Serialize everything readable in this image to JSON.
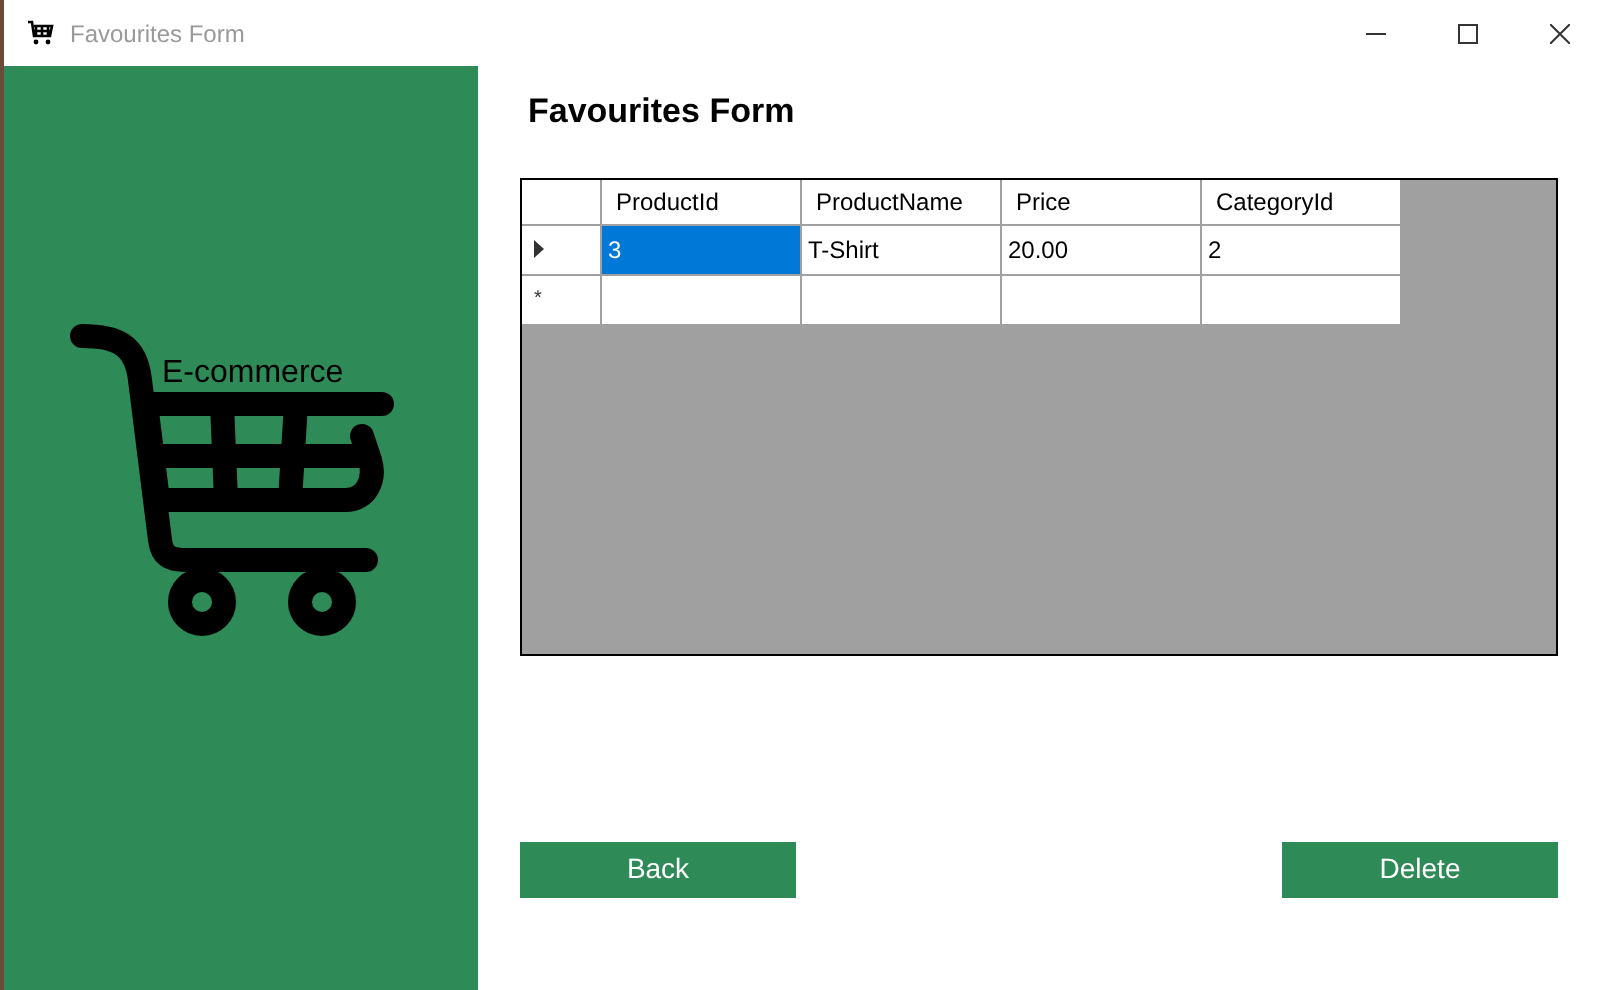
{
  "window": {
    "title": "Favourites Form"
  },
  "sidebar": {
    "logo_text": "E-commerce"
  },
  "heading": "Favourites Form",
  "table": {
    "columns": [
      "ProductId",
      "ProductName",
      "Price",
      "CategoryId"
    ],
    "rows": [
      {
        "current": true,
        "cells": [
          {
            "text": "3",
            "selected": true
          },
          {
            "text": "T-Shirt",
            "selected": false
          },
          {
            "text": "20.00",
            "selected": false
          },
          {
            "text": "2",
            "selected": false
          }
        ]
      }
    ],
    "new_row": {
      "marker": "*"
    }
  },
  "buttons": [
    {
      "label": "Back"
    },
    {
      "label": "Delete"
    }
  ]
}
